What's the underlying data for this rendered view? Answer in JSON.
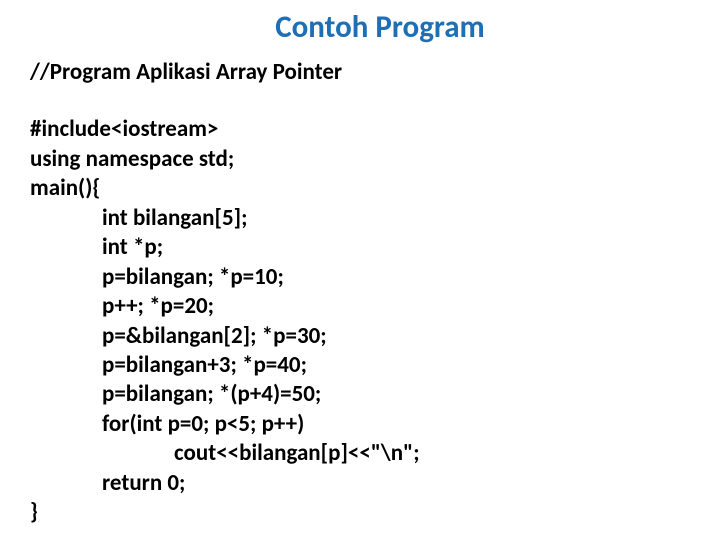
{
  "title": "Contoh Program",
  "code": {
    "comment": "//Program Aplikasi Array Pointer",
    "line1": "#include<iostream>",
    "line2": "using namespace std;",
    "line3": "main(){",
    "line4": "int bilangan[5];",
    "line5": "int *p;",
    "line6": "p=bilangan;  *p=10;",
    "line7": "p++;  *p=20;",
    "line8": "p=&bilangan[2];  *p=30;",
    "line9": "p=bilangan+3; *p=40;",
    "line10": "p=bilangan; *(p+4)=50;",
    "line11": "for(int p=0; p<5; p++)",
    "line12": "cout<<bilangan[p]<<\"\\n\";",
    "line13": "return 0;",
    "line14": "}"
  }
}
